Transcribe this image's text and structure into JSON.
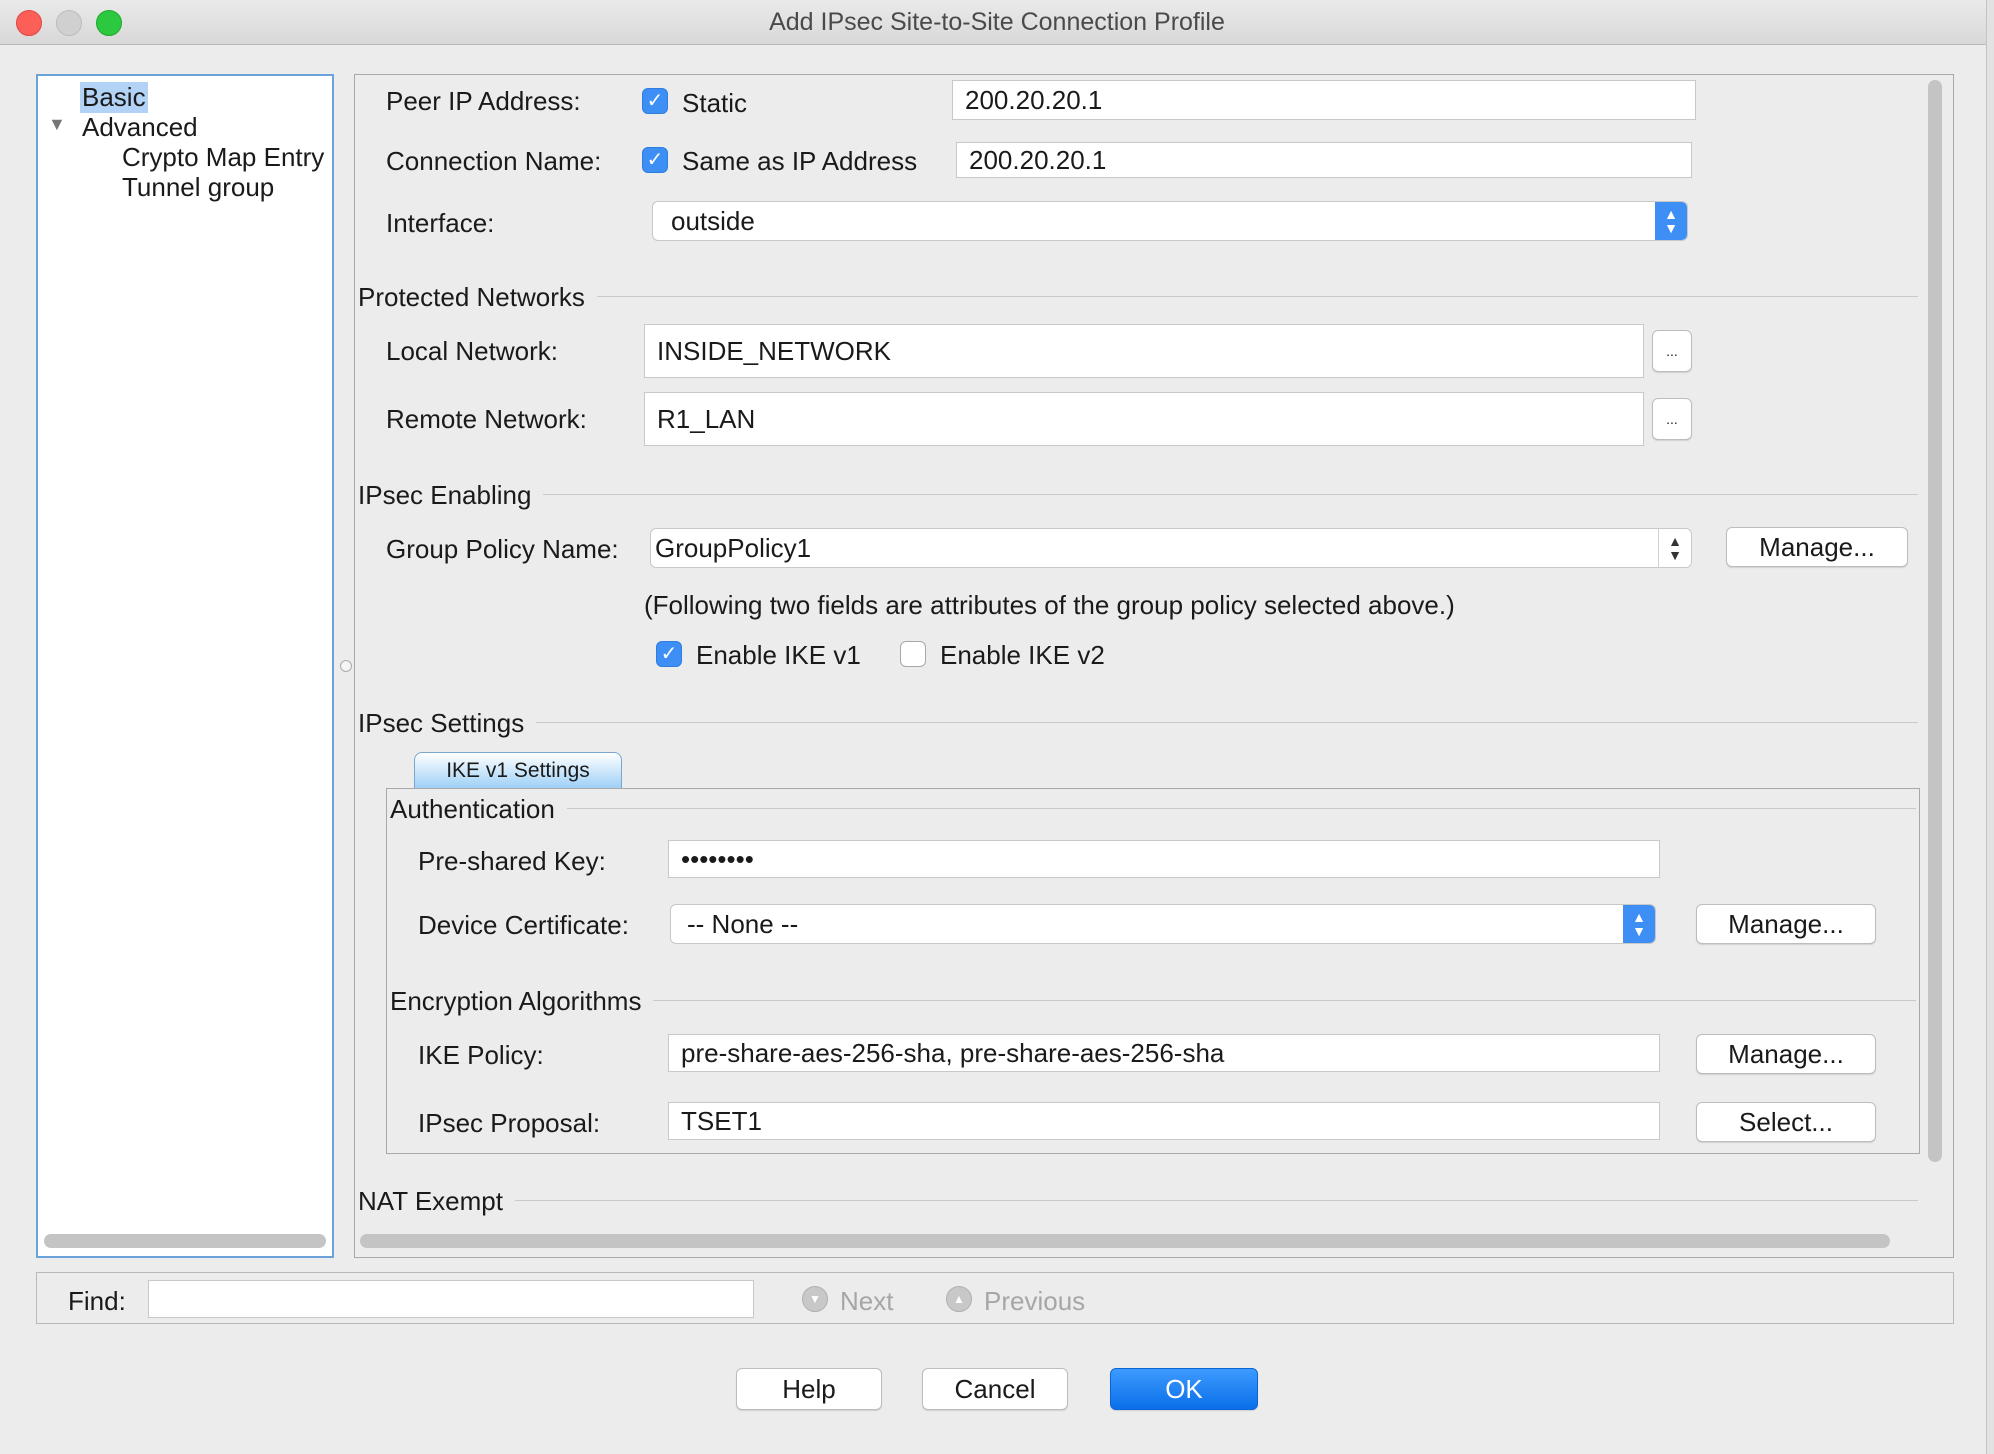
{
  "window": {
    "title": "Add IPsec Site-to-Site Connection Profile"
  },
  "tree": {
    "items": [
      {
        "label": "Basic",
        "selected": true
      },
      {
        "label": "Advanced",
        "expanded": true
      },
      {
        "label": "Crypto Map Entry"
      },
      {
        "label": "Tunnel group"
      }
    ],
    "expand_icon": "disclosure-triangle-down-icon"
  },
  "basic": {
    "peer_ip_label": "Peer IP Address:",
    "static_label": "Static",
    "static_checked": true,
    "peer_ip_value": "200.20.20.1",
    "connection_name_label": "Connection Name:",
    "same_as_ip_label": "Same as IP Address",
    "same_as_ip_checked": true,
    "connection_name_value": "200.20.20.1",
    "interface_label": "Interface:",
    "interface_value": "outside"
  },
  "protected_networks": {
    "title": "Protected Networks",
    "local_label": "Local Network:",
    "local_value": "INSIDE_NETWORK",
    "remote_label": "Remote Network:",
    "remote_value": "R1_LAN",
    "browse_label": "..."
  },
  "ipsec_enabling": {
    "title": "IPsec Enabling",
    "group_policy_label": "Group Policy Name:",
    "group_policy_value": "GroupPolicy1",
    "manage_label": "Manage...",
    "note": "(Following two fields are attributes of the group policy selected above.)",
    "ike_v1_label": "Enable IKE v1",
    "ike_v1_checked": true,
    "ike_v2_label": "Enable IKE v2",
    "ike_v2_checked": false
  },
  "ipsec_settings": {
    "title": "IPsec Settings",
    "tab_label": "IKE v1 Settings",
    "authentication_title": "Authentication",
    "psk_label": "Pre-shared Key:",
    "psk_value": "••••••••",
    "device_cert_label": "Device Certificate:",
    "device_cert_value": "-- None --",
    "device_cert_manage_label": "Manage...",
    "encryption_title": "Encryption Algorithms",
    "ike_policy_label": "IKE Policy:",
    "ike_policy_value": "pre-share-aes-256-sha, pre-share-aes-256-sha",
    "ike_policy_manage_label": "Manage...",
    "ipsec_proposal_label": "IPsec Proposal:",
    "ipsec_proposal_value": "TSET1",
    "select_label": "Select..."
  },
  "nat": {
    "title": "NAT Exempt"
  },
  "find": {
    "label": "Find:",
    "value": "",
    "next_label": "Next",
    "previous_label": "Previous"
  },
  "footer": {
    "help_label": "Help",
    "cancel_label": "Cancel",
    "ok_label": "OK"
  },
  "colors": {
    "accent": "#3d8ff5",
    "selection": "#b3d3f6"
  }
}
